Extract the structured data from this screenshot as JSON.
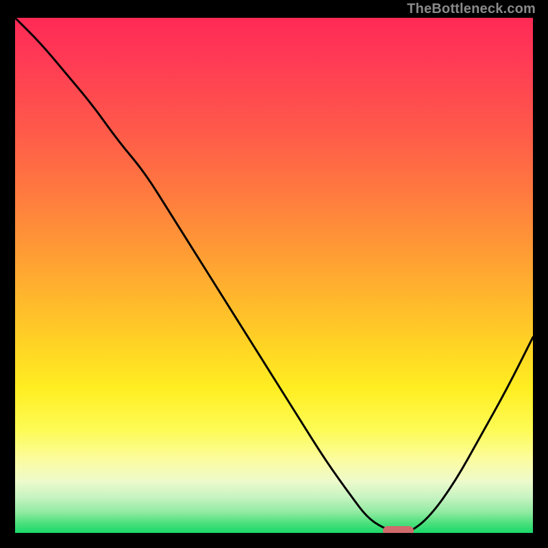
{
  "watermark": "TheBottleneck.com",
  "colors": {
    "black": "#000000",
    "curve": "#000000",
    "marker": "#cf6b6d",
    "gradient_top": "#ff2a55",
    "gradient_bottom": "#19d96a"
  },
  "chart_data": {
    "type": "line",
    "title": "",
    "xlabel": "",
    "ylabel": "",
    "xlim": [
      0,
      100
    ],
    "ylim": [
      0,
      100
    ],
    "x": [
      0,
      5,
      10,
      15,
      20,
      25,
      30,
      35,
      40,
      45,
      50,
      55,
      60,
      65,
      68,
      71,
      74,
      76,
      80,
      85,
      90,
      95,
      100
    ],
    "values": [
      100,
      95,
      89,
      83,
      76,
      70,
      62,
      54,
      46,
      38,
      30,
      22,
      14,
      7,
      3,
      1,
      0,
      0,
      3,
      10,
      19,
      28,
      38
    ],
    "marker": {
      "x_start": 71,
      "x_end": 77,
      "y": 0
    },
    "grid": false
  }
}
